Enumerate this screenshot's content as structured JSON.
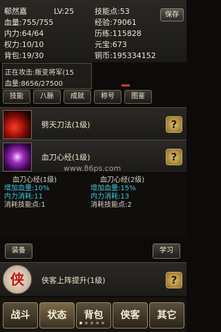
{
  "stats": {
    "name": "郗然嘉",
    "level": "LV:25",
    "skill_points": "技能点:53",
    "hp": "血量:755/755",
    "exp": "经验:79061",
    "internal": "内力:64/64",
    "training": "历练:115828",
    "power": "权力:10/10",
    "yuanbao": "元宝:673",
    "bag": "背包:19/30",
    "copper": "铜币:195334152",
    "save_label": "保存"
  },
  "attack": {
    "line1": "正在攻击:叛变将军(15",
    "line2": "血量:8656/27500"
  },
  "tabs": [
    "技能",
    "八脉",
    "成就",
    "称号",
    "图鉴"
  ],
  "skills": [
    {
      "name": "劈天刀法(1级)",
      "icon": "red-slash-skill-icon"
    },
    {
      "name": "血刀心经(1级)",
      "icon": "purple-sword-skill-icon"
    }
  ],
  "watermark": "www.86ps.com",
  "detail": {
    "current": {
      "title": "血刀心经(1级)",
      "effect": "增加血量:10%",
      "cost": "内力消耗:11",
      "sp": "消耗技能点:1"
    },
    "next": {
      "title": "血刀心经(2级)",
      "effect": "增加血量:15%",
      "cost": "内力消耗:13",
      "sp": "消耗技能点:2"
    }
  },
  "side_buttons": {
    "equip": "装备",
    "learn": "学习"
  },
  "passive": {
    "name": "侠客上阵提升(1级)",
    "icon_char": "侠"
  },
  "bottom_nav": [
    "战斗",
    "状态",
    "背包",
    "侠客",
    "其它"
  ],
  "colors": {
    "cyan": "#3cc8e0",
    "accent": "#c9a760"
  }
}
